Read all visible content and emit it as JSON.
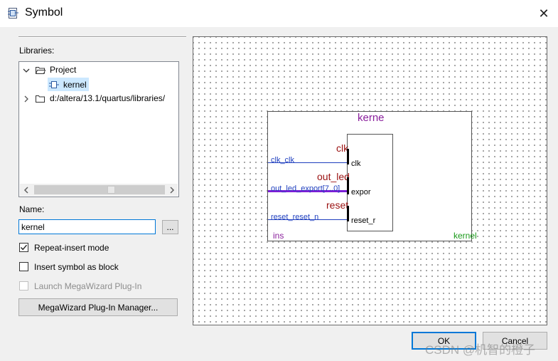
{
  "window": {
    "title": "Symbol",
    "close_glyph": "✕"
  },
  "libraries": {
    "label": "Libraries:",
    "tree": [
      {
        "label": "Project",
        "expanded": true,
        "icon": "folder-open-icon"
      },
      {
        "label": "kernel",
        "selected": true,
        "icon": "symbol-icon"
      },
      {
        "label": "d:/altera/13.1/quartus/libraries/",
        "expanded": false,
        "icon": "folder-icon"
      }
    ],
    "scroll_left": "‹",
    "scroll_right": "›"
  },
  "name": {
    "label": "Name:",
    "value": "kernel",
    "browse_label": "..."
  },
  "options": {
    "repeat_insert": {
      "label": "Repeat-insert mode",
      "checked": true
    },
    "insert_as_block": {
      "label": "Insert symbol as block",
      "checked": false
    },
    "launch_megawizard": {
      "label": "Launch MegaWizard Plug-In",
      "checked": false,
      "disabled": true
    }
  },
  "megawizard_button": "MegaWizard Plug-In Manager...",
  "preview": {
    "title": "kerne",
    "pins": [
      {
        "header": "clk",
        "wire_label": "clk_clk",
        "port": "clk"
      },
      {
        "header": "out_led",
        "wire_label": "out_led_export[7..0]",
        "port": "expor"
      },
      {
        "header": "reset",
        "wire_label": "reset_reset_n",
        "port": "reset_r"
      }
    ],
    "instance_label": "ins",
    "footer_label": "kernel",
    "colors": {
      "title": "#8a1f9c",
      "header": "#9a1010",
      "wire_label": "#1f3fbf",
      "instance": "#8a1f9c",
      "footer": "#1a9a1a",
      "bus": "#7b1fd6"
    }
  },
  "buttons": {
    "ok": "OK",
    "cancel": "Cancel"
  },
  "watermark": "CSDN @机智的橙子"
}
